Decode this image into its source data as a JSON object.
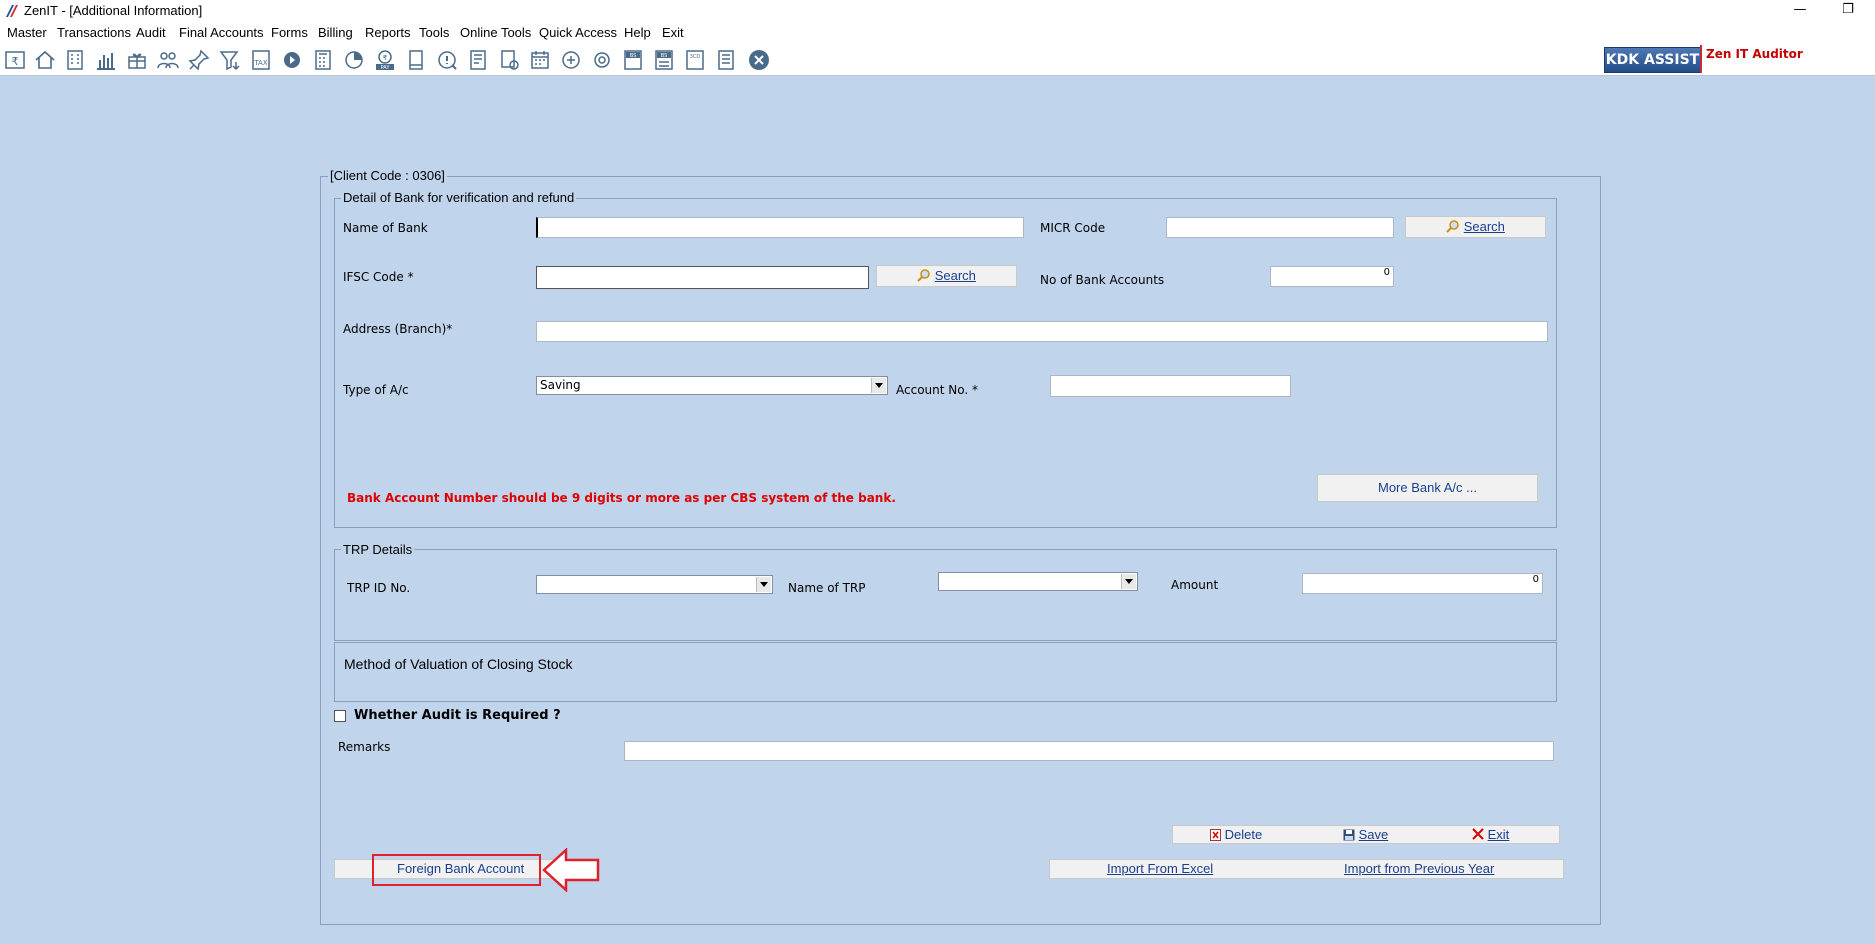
{
  "window": {
    "title": "ZenIT - [Additional Information]",
    "minimize": "—",
    "restore": "❐"
  },
  "menu": [
    "Master",
    "Transactions",
    "Audit",
    "Final Accounts",
    "Forms",
    "Billing",
    "Reports",
    "Tools",
    "Online Tools",
    "Quick Access",
    "Help",
    "Exit"
  ],
  "toolbar": {
    "icons": [
      "rupee-ledger",
      "home",
      "building",
      "bar-chart",
      "gift",
      "users",
      "pin",
      "filter",
      "tax",
      "disc",
      "calculator",
      "pie-chart",
      "pay",
      "book",
      "document-search",
      "form",
      "person-card",
      "calendar",
      "globe",
      "settings",
      "balance-sheet",
      "balance-sheet-2",
      "3cd",
      "sheet",
      "close-circle"
    ],
    "tax_label": "TAX",
    "pay_label": "PAY",
    "bs_label": "BS",
    "cd_label": "3CD",
    "kdk_assist": "KDK ASSIST",
    "product_name": "Zen IT Auditor"
  },
  "form": {
    "client_code": "[Client Code : 0306]",
    "bank_group_title": "Detail of Bank for verification and refund",
    "name_of_bank_label": "Name of Bank",
    "name_of_bank_value": "",
    "micr_code_label": "MICR Code",
    "micr_code_value": "",
    "search_label": "Search",
    "ifsc_label": "IFSC Code *",
    "ifsc_value": "",
    "no_of_accounts_label": "No of Bank Accounts",
    "no_of_accounts_value": "0",
    "address_label": "Address (Branch)*",
    "address_value": "",
    "type_ac_label": "Type of A/c",
    "type_ac_value": "Saving",
    "account_no_label": "Account No. *",
    "account_no_value": "",
    "warning": "Bank Account Number should be 9 digits or more as per CBS system of the bank.",
    "more_bank_label": "More Bank A/c ...",
    "trp_group_title": "TRP Details",
    "trp_id_label": "TRP ID No.",
    "trp_id_value": "",
    "trp_name_label": "Name of TRP",
    "trp_name_value": "",
    "amount_label": "Amount",
    "amount_value": "0",
    "valuation_label": "Method of Valuation of Closing Stock",
    "audit_label": "Whether Audit is Required ?",
    "audit_checked": false,
    "remarks_label": "Remarks",
    "remarks_value": ""
  },
  "actions": {
    "delete": "Delete",
    "save": "Save",
    "exit": "Exit",
    "foreign_bank": "Foreign Bank Account",
    "import_excel": "Import From Excel",
    "import_prev": "Import from Previous Year"
  },
  "colors": {
    "background": "#c0d4ec",
    "link_blue": "#1a3f8f",
    "warning_red": "#e00000",
    "highlight_red": "#e0212b"
  }
}
